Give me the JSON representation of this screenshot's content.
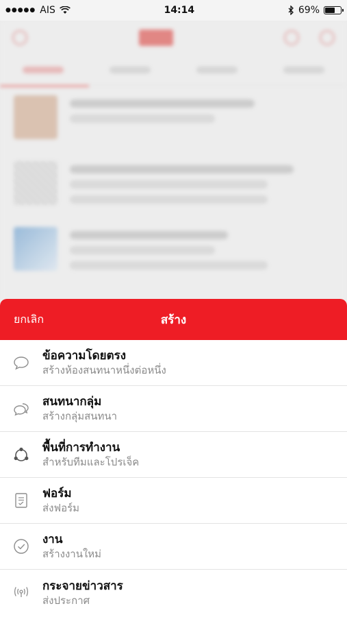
{
  "status_bar": {
    "carrier": "AIS",
    "time": "14:14",
    "battery_percent": "69%",
    "battery_level": 0.69
  },
  "sheet": {
    "cancel_label": "ยกเลิก",
    "title": "สร้าง",
    "accent_color": "#ee1d25",
    "items": [
      {
        "icon": "chat-bubble-icon",
        "title": "ข้อความโดยตรง",
        "subtitle": "สร้างห้องสนทนาหนึ่งต่อหนึ่ง"
      },
      {
        "icon": "group-chat-icon",
        "title": "สนทนากลุ่ม",
        "subtitle": "สร้างกลุ่มสนทนา"
      },
      {
        "icon": "workspace-icon",
        "title": "พื้นที่การทำงาน",
        "subtitle": "สำหรับทีมและโปรเจ็ค"
      },
      {
        "icon": "form-icon",
        "title": "ฟอร์ม",
        "subtitle": "ส่งฟอร์ม"
      },
      {
        "icon": "task-check-icon",
        "title": "งาน",
        "subtitle": "สร้างงานใหม่"
      },
      {
        "icon": "broadcast-icon",
        "title": "กระจายข่าวสาร",
        "subtitle": "ส่งประกาศ"
      }
    ]
  }
}
